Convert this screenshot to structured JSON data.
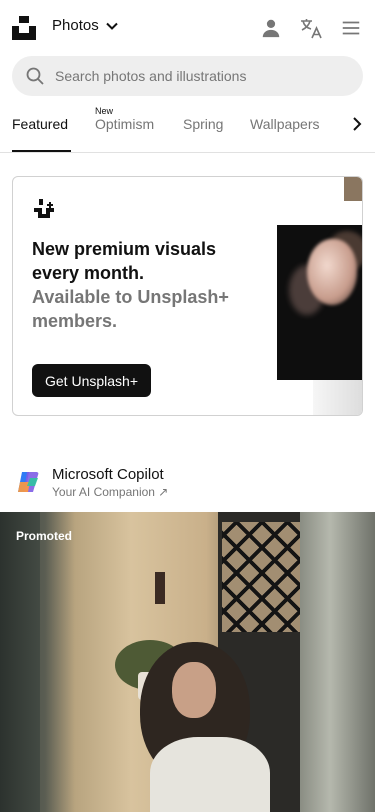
{
  "header": {
    "type_label": "Photos",
    "icons": [
      "unsplash-logo",
      "chevron-down-icon",
      "user-icon",
      "translate-icon",
      "menu-icon"
    ]
  },
  "search": {
    "placeholder": "Search photos and illustrations"
  },
  "tabs": {
    "items": [
      {
        "label": "Featured",
        "active": true
      },
      {
        "label": "Optimism",
        "badge": "New"
      },
      {
        "label": "Spring"
      },
      {
        "label": "Wallpapers"
      }
    ]
  },
  "promo": {
    "headline": "New premium visuals every month.",
    "subline": "Available to Unsplash+ members.",
    "button_label": "Get Unsplash+"
  },
  "sponsor": {
    "name": "Microsoft Copilot",
    "tagline": "Your AI Companion ↗"
  },
  "photo": {
    "badge": "Promoted"
  },
  "colors": {
    "text_primary": "#111111",
    "text_secondary": "#767676",
    "search_bg": "#eeeeee",
    "button_bg": "#111111"
  }
}
